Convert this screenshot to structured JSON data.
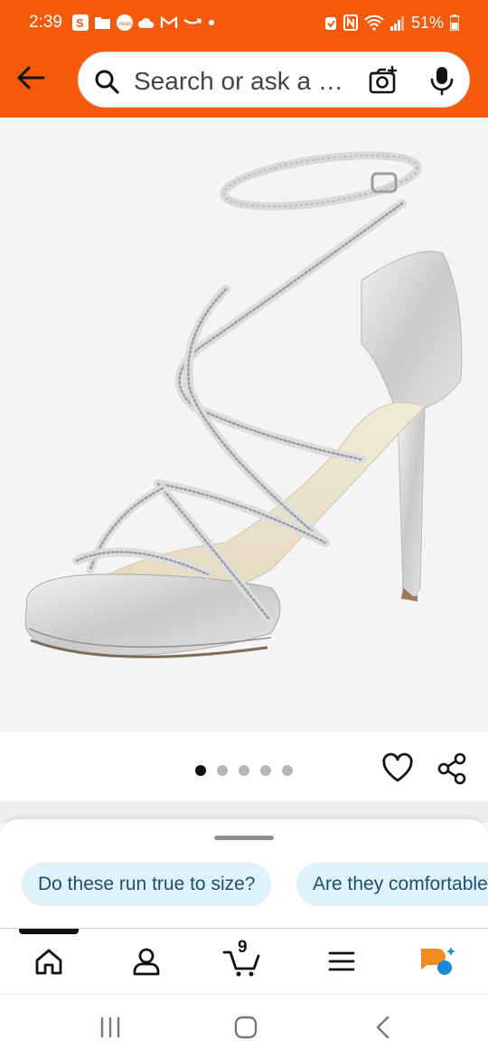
{
  "status_bar": {
    "time": "2:39",
    "battery": "51%",
    "left_icons": [
      "s-app-icon",
      "folder-icon",
      "news-icon",
      "cloud-icon",
      "gmail-icon",
      "amazon-icon",
      "dot-icon"
    ],
    "right_icons": [
      "alarm-icon",
      "nfc-icon",
      "wifi-icon",
      "signal-icon",
      "battery-icon"
    ]
  },
  "header": {
    "back_icon": "arrow-left-icon",
    "search_placeholder": "Search or ask a question",
    "camera_icon": "camera-icon",
    "mic_icon": "microphone-icon",
    "accent_color": "#f55a0c"
  },
  "product": {
    "image_icon": "strappy-silver-heeled-sandal",
    "image_count": 5,
    "active_image_index": 0
  },
  "actions": {
    "wishlist_icon": "heart-icon",
    "share_icon": "share-icon"
  },
  "rufus": {
    "suggestions": [
      "Do these run true to size?",
      "Are they comfortable?"
    ],
    "chip_color": "#dff1f9"
  },
  "bottom_nav": {
    "cart_count": "9",
    "items": [
      "home-icon",
      "account-icon",
      "cart-icon",
      "menu-icon",
      "rufus-icon"
    ],
    "active": "home"
  },
  "system_nav": {
    "buttons": [
      "recents-icon",
      "home-icon",
      "back-icon"
    ]
  }
}
